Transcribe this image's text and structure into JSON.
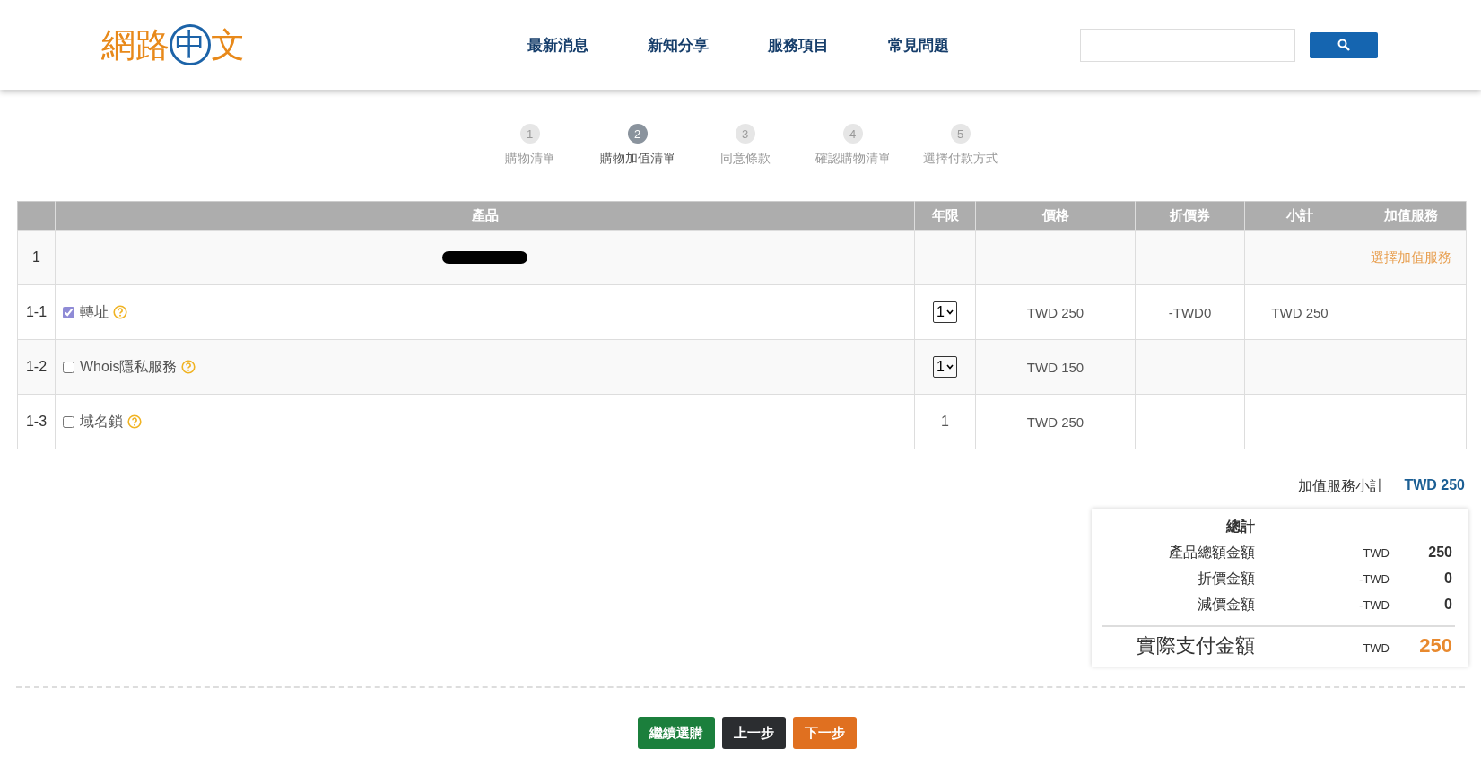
{
  "header": {
    "logo": [
      "網路",
      "中",
      "文"
    ],
    "nav": [
      "最新消息",
      "新知分享",
      "服務項目",
      "常見問題"
    ]
  },
  "steps": [
    {
      "number": "1",
      "label": "購物清單",
      "selected": false
    },
    {
      "number": "2",
      "label": "購物加值清單",
      "selected": true
    },
    {
      "number": "3",
      "label": "同意條款",
      "selected": false
    },
    {
      "number": "4",
      "label": "確認購物清單",
      "selected": false
    },
    {
      "number": "5",
      "label": "選擇付款方式",
      "selected": false
    }
  ],
  "table": {
    "columns": [
      "產品",
      "年限",
      "價格",
      "折價券",
      "小計",
      "加值服務"
    ],
    "rows": [
      {
        "index": "1",
        "kind": "product",
        "action": "選擇加值服務"
      },
      {
        "index": "1-1",
        "kind": "addon",
        "name": "轉址",
        "checked": true,
        "years": "1",
        "years_editable": true,
        "price": "TWD 250",
        "coupon": "-TWD0",
        "subtotal": "TWD 250"
      },
      {
        "index": "1-2",
        "kind": "addon",
        "name": "Whois隱私服務",
        "checked": false,
        "years": "1",
        "years_editable": true,
        "price": "TWD 150"
      },
      {
        "index": "1-3",
        "kind": "addon",
        "name": "域名鎖",
        "checked": false,
        "years": "1",
        "years_editable": false,
        "price": "TWD 250"
      }
    ]
  },
  "addon_subtotal": {
    "label": "加值服務小計",
    "value": "TWD 250"
  },
  "summary": {
    "title": "總計",
    "lines": [
      {
        "label": "產品總額金額",
        "currency": "TWD",
        "amount": "250"
      },
      {
        "label": "折價金額",
        "currency": "-TWD",
        "amount": "0"
      },
      {
        "label": "減價金額",
        "currency": "-TWD",
        "amount": "0"
      }
    ],
    "total": {
      "label": "實際支付金額",
      "currency": "TWD",
      "amount": "250"
    }
  },
  "buttons": [
    {
      "label": "繼續選購",
      "kind": "continue"
    },
    {
      "label": "上一步",
      "kind": "back"
    },
    {
      "label": "下一步",
      "kind": "next"
    }
  ]
}
